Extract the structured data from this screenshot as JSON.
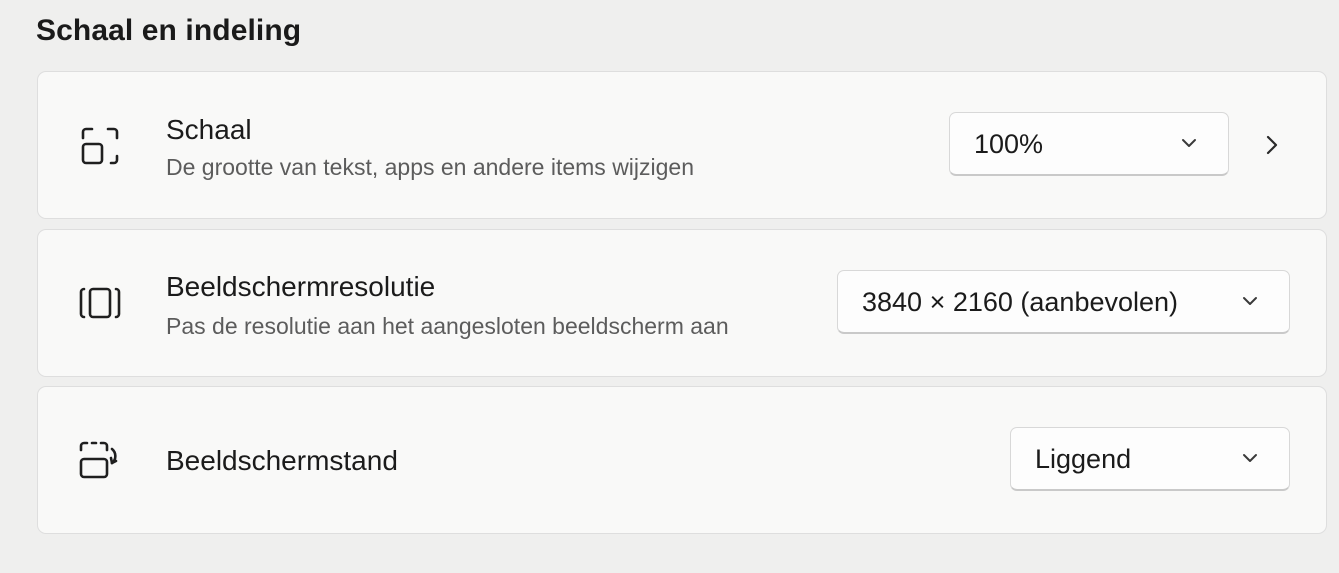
{
  "section": {
    "title": "Schaal en indeling"
  },
  "settings": [
    {
      "icon": "scale-icon",
      "title": "Schaal",
      "description": "De grootte van tekst, apps en andere items wijzigen",
      "dropdown_value": "100%",
      "has_link_chevron": true
    },
    {
      "icon": "display-resolution-icon",
      "title": "Beeldschermresolutie",
      "description": "Pas de resolutie aan het aangesloten beeldscherm aan",
      "dropdown_value": "3840 × 2160 (aanbevolen)",
      "has_link_chevron": false
    },
    {
      "icon": "display-orientation-icon",
      "title": "Beeldschermstand",
      "description": "",
      "dropdown_value": "Liggend",
      "has_link_chevron": false
    }
  ]
}
